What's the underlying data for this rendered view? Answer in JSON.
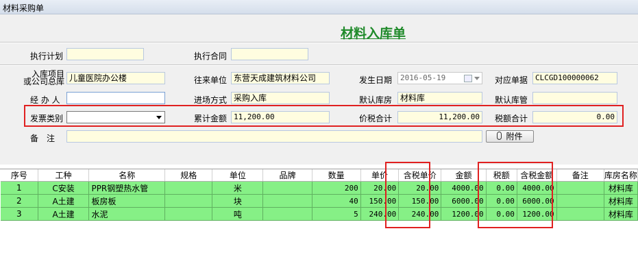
{
  "window": {
    "title": "材料采购单"
  },
  "form": {
    "heading": "材料入库单",
    "exec_plan": {
      "label": "执行计划",
      "value": ""
    },
    "exec_contract": {
      "label": "执行合同",
      "value": ""
    },
    "project": {
      "label_line1": "入库项目",
      "label_line2": "或公司总库",
      "value": "儿童医院办公楼"
    },
    "partner": {
      "label": "往来单位",
      "value": "东营天成建筑材料公司"
    },
    "date": {
      "label": "发生日期",
      "value": "2016-05-19"
    },
    "ref_doc": {
      "label": "对应单据",
      "value": "CLCGD100000062"
    },
    "handler": {
      "label": "经 办 人",
      "value": ""
    },
    "entry_method": {
      "label": "进场方式",
      "value": "采购入库"
    },
    "default_warehouse": {
      "label": "默认库房",
      "value": "材料库"
    },
    "default_keeper": {
      "label": "默认库管",
      "value": ""
    },
    "invoice_type": {
      "label": "发票类别",
      "value": ""
    },
    "total_amount": {
      "label": "累计金额",
      "value": "11,200.00"
    },
    "total_with_tax": {
      "label": "价税合计",
      "value": "11,200.00"
    },
    "tax_total": {
      "label": "税额合计",
      "value": "0.00"
    },
    "remark": {
      "label": "备　注",
      "value": ""
    },
    "attach_button": "附件"
  },
  "table": {
    "columns": [
      "序号",
      "工种",
      "名称",
      "规格",
      "单位",
      "品牌",
      "数量",
      "单价",
      "含税单价",
      "金额",
      "税额",
      "含税金额",
      "备注",
      "库房名称"
    ],
    "rows": [
      [
        "1",
        "C安装",
        "PPR钢塑热水管",
        "",
        "米",
        "",
        "200",
        "20.00",
        "20.00",
        "4000.00",
        "0.00",
        "4000.00",
        "",
        "材料库"
      ],
      [
        "2",
        "A土建",
        "板房板",
        "",
        "块",
        "",
        "40",
        "150.00",
        "150.00",
        "6000.00",
        "0.00",
        "6000.00",
        "",
        "材料库"
      ],
      [
        "3",
        "A土建",
        "水泥",
        "",
        "吨",
        "",
        "5",
        "240.00",
        "240.00",
        "1200.00",
        "0.00",
        "1200.00",
        "",
        "材料库"
      ]
    ]
  },
  "colors": {
    "row_highlight": "#86f086",
    "field_bg": "#fffde0",
    "heading": "#1f8a2a",
    "annotation": "#e02020"
  }
}
